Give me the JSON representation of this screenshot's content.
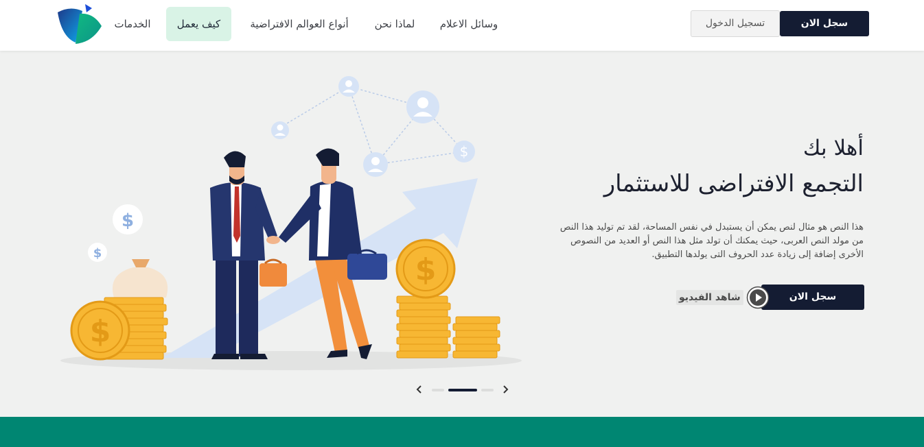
{
  "header": {
    "logo_icon": "brand-logo-icon",
    "nav": [
      {
        "label": "الخدمات",
        "active": false
      },
      {
        "label": "كيف يعمل",
        "active": true
      },
      {
        "label": "أنواع العوالم الافتراضية",
        "active": false
      },
      {
        "label": "لماذا نحن",
        "active": false
      },
      {
        "label": "وسائل الاعلام",
        "active": false
      }
    ],
    "login_label": "تسجيل الدخول",
    "register_label": "سجل الان"
  },
  "hero": {
    "welcome": "أهلا بك",
    "headline": "التجمع الافتراضى للاستثمار",
    "paragraph": "هذا النص هو مثال لنص يمكن أن يستبدل في نفس المساحة، لقد تم توليد هذا النص من مولد النص العربى، حيث يمكنك أن تولد مثل هذا النص أو العديد من النصوص الأخرى إضافة إلى زيادة عدد الحروف التى يولدها التطبيق.",
    "register_label": "سجل الان",
    "watch_label": "شاهد الفيديو",
    "play_icon": "play-icon"
  },
  "slider": {
    "slide_count": 3,
    "active_index": 1,
    "prev_icon": "chevron-left-icon",
    "next_icon": "chevron-right-icon"
  },
  "colors": {
    "primary_dark": "#141c33",
    "accent_green": "#008672",
    "nav_active_bg": "#d9f3e6",
    "background": "#f0f1f0"
  }
}
